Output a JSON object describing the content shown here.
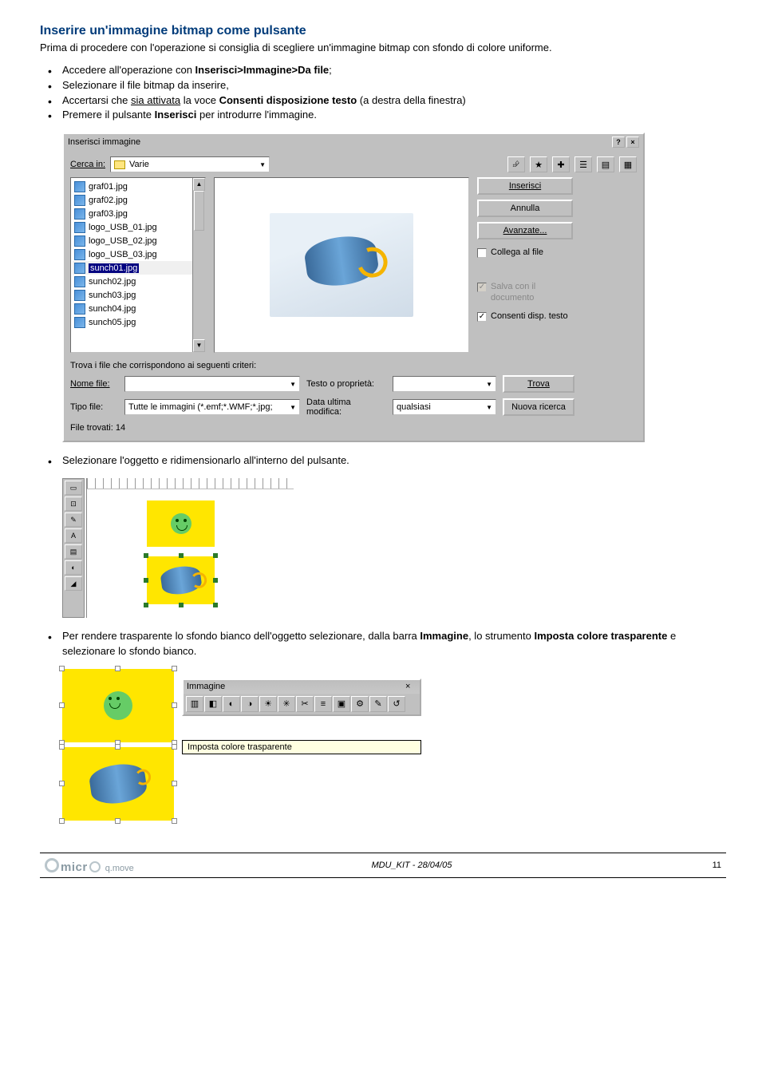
{
  "heading": "Inserire un'immagine bitmap come pulsante",
  "intro": "Prima di procedere con l'operazione si consiglia di scegliere un'immagine bitmap con sfondo di colore uniforme.",
  "bullets1": {
    "a_pre": "Accedere all'operazione con ",
    "a_bold": "Inserisci>Immagine>Da file",
    "a_post": ";",
    "b": "Selezionare il file bitmap da inserire,",
    "c_pre": "Accertarsi che ",
    "c_ul": "sia attivata",
    "c_mid": " la voce ",
    "c_bold": "Consenti disposizione testo",
    "c_post": " (a destra della finestra)",
    "d_pre": "Premere il pulsante ",
    "d_bold": "Inserisci",
    "d_post": " per introdurre l'immagine."
  },
  "dialog": {
    "title": "Inserisci immagine",
    "help": "?",
    "close": "×",
    "cerca_label": "Cerca in:",
    "cerca_value": "Varie",
    "files": [
      "graf01.jpg",
      "graf02.jpg",
      "graf03.jpg",
      "logo_USB_01.jpg",
      "logo_USB_02.jpg",
      "logo_USB_03.jpg",
      "sunch01.jpg",
      "sunch02.jpg",
      "sunch03.jpg",
      "sunch04.jpg",
      "sunch05.jpg"
    ],
    "selected_index": 6,
    "btn_inserisci": "Inserisci",
    "btn_annulla": "Annulla",
    "btn_avanzate": "Avanzate...",
    "chk_collega": "Collega al file",
    "chk_salva": "Salva con il documento",
    "chk_consenti": "Consenti disp. testo",
    "search_caption": "Trova i file che corrispondono ai seguenti criteri:",
    "nome_label": "Nome file:",
    "testo_label": "Testo o proprietà:",
    "tipo_label": "Tipo file:",
    "tipo_value": "Tutte le immagini (*.emf;*.WMF;*.jpg;",
    "data_label": "Data ultima modifica:",
    "data_value": "qualsiasi",
    "btn_trova": "Trova",
    "btn_nuova": "Nuova ricerca",
    "found": "File trovati: 14"
  },
  "bullet2": "Selezionare l'oggetto e ridimensionarlo all'interno del pulsante.",
  "bullet3": {
    "pre": "Per rendere trasparente lo sfondo bianco dell'oggetto selezionare, dalla barra ",
    "b1": "Immagine",
    "mid": ", lo strumento ",
    "b2": "Imposta colore trasparente",
    "post": " e selezionare lo sfondo bianco."
  },
  "imgbar": {
    "title": "Immagine",
    "close": "×",
    "tooltip": "Imposta colore trasparente"
  },
  "footer": {
    "brand1": "micr",
    "brand2": "q.move",
    "center": "MDU_KIT - 28/04/05",
    "page": "11"
  }
}
